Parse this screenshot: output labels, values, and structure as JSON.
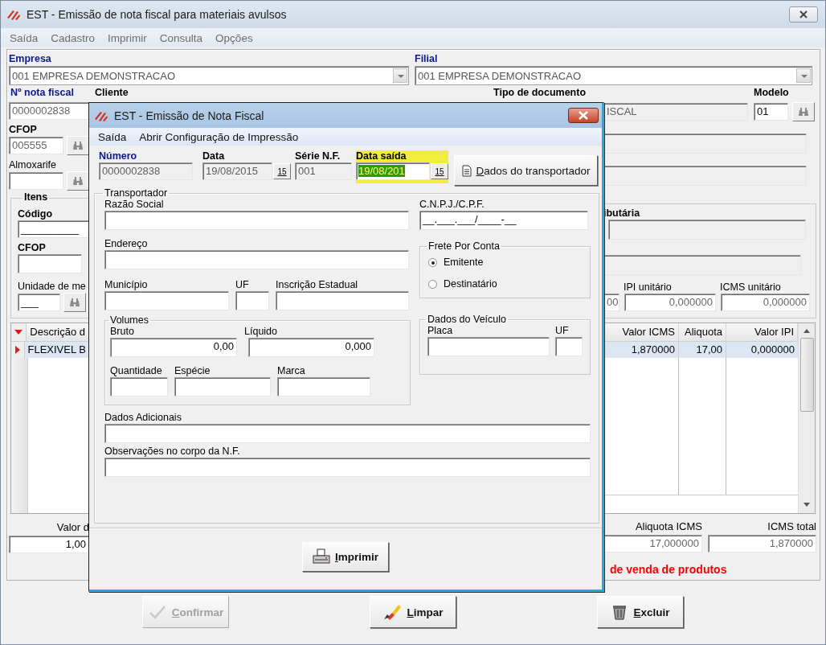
{
  "window": {
    "title": "EST - Emissão de nota fiscal para materiais avulsos"
  },
  "menu": [
    "Saída",
    "Cadastro",
    "Imprimir",
    "Consulta",
    "Opções"
  ],
  "empresa": {
    "label": "Empresa",
    "value": "001 EMPRESA DEMONSTRACAO"
  },
  "filial": {
    "label": "Filial",
    "value": "001 EMPRESA DEMONSTRACAO"
  },
  "nota": {
    "label": "Nº nota fiscal",
    "value": "0000002838"
  },
  "cliente": {
    "label": "Cliente"
  },
  "tipo_documento": {
    "label": "Tipo de documento",
    "value": "ISCAL"
  },
  "modelo": {
    "label": "Modelo",
    "value": "01"
  },
  "cfop": {
    "label": "CFOP",
    "value": "005555"
  },
  "almoxarife": {
    "label": "Almoxarife"
  },
  "itens": {
    "title": "Itens",
    "codigo": {
      "label": "Código",
      "value": "__________"
    },
    "cfop": {
      "label": "CFOP"
    },
    "unidade": {
      "label": "Unidade de me",
      "value": "___"
    },
    "tributaria": {
      "label": "ibutária"
    },
    "partial_value": "00",
    "ipi": {
      "label": "IPI unitário",
      "value": "0,000000"
    },
    "icms": {
      "label": "ICMS unitário",
      "value": "0,000000"
    }
  },
  "grid": {
    "columns": [
      "Descrição d",
      "Valor ICMS",
      "Aliquota",
      "Valor IPI"
    ],
    "rows": [
      {
        "cells": [
          "FLEXIVEL B",
          "1,870000",
          "17,00",
          "0,000000"
        ],
        "selected": true
      }
    ]
  },
  "totals": [
    {
      "label": "Valor d",
      "value": "1,00"
    },
    {
      "label": "Aliquota ICMS",
      "value": "17,000000"
    },
    {
      "label": "ICMS total",
      "value": "1,870000"
    }
  ],
  "warning": "de venda de produtos",
  "buttons": [
    {
      "label": "Confirmar",
      "kind": "confirm",
      "disabled": true
    },
    {
      "label": "Limpar",
      "kind": "clear",
      "disabled": false
    },
    {
      "label": "Excluir",
      "kind": "delete",
      "disabled": false
    }
  ],
  "dialog": {
    "title": "EST - Emissão de Nota Fiscal",
    "menu": [
      "Saída",
      "Abrir Configuração de Impressão"
    ],
    "header_fields": [
      {
        "label": "Número",
        "value": "0000002838",
        "kind": "text",
        "required": true,
        "disabled": true,
        "focused": false
      },
      {
        "label": "Data",
        "value": "19/08/2015",
        "kind": "date",
        "calendar": "15",
        "required": false,
        "disabled": true,
        "focused": false
      },
      {
        "label": "Série N.F.",
        "value": "001",
        "kind": "text",
        "required": false,
        "disabled": true,
        "focused": false
      },
      {
        "label": "Data saída",
        "value": "19/08/201",
        "kind": "date",
        "calendar": "15",
        "required": false,
        "disabled": false,
        "focused": true
      }
    ],
    "transport_button": "Dados do transportador",
    "transportador": {
      "title": "Transportador",
      "razao_social": {
        "label": "Razão Social"
      },
      "cnpj": {
        "label": "C.N.P.J./C.P.F.",
        "value": "__.___.___/____-__"
      },
      "endereco": {
        "label": "Endereço"
      },
      "municipio": {
        "label": "Município"
      },
      "uf": {
        "label": "UF"
      },
      "inscricao": {
        "label": "Inscrição Estadual"
      }
    },
    "frete": {
      "title": "Frete Por Conta",
      "options": [
        {
          "label": "Emitente",
          "selected": true
        },
        {
          "label": "Destinatário",
          "selected": false
        }
      ]
    },
    "volumes": {
      "title": "Volumes",
      "bruto": {
        "label": "Bruto",
        "value": "0,00"
      },
      "liquido": {
        "label": "Líquido",
        "value": "0,000"
      },
      "quantidade": {
        "label": "Quantidade"
      },
      "especie": {
        "label": "Espécie"
      },
      "marca": {
        "label": "Marca"
      }
    },
    "veiculo": {
      "title": "Dados do Veículo",
      "placa": {
        "label": "Placa"
      },
      "uf": {
        "label": "UF"
      }
    },
    "adicionais": {
      "label": "Dados Adicionais"
    },
    "observacoes": {
      "label": "Observações no corpo da N.F."
    },
    "print_button": "Imprimir"
  }
}
